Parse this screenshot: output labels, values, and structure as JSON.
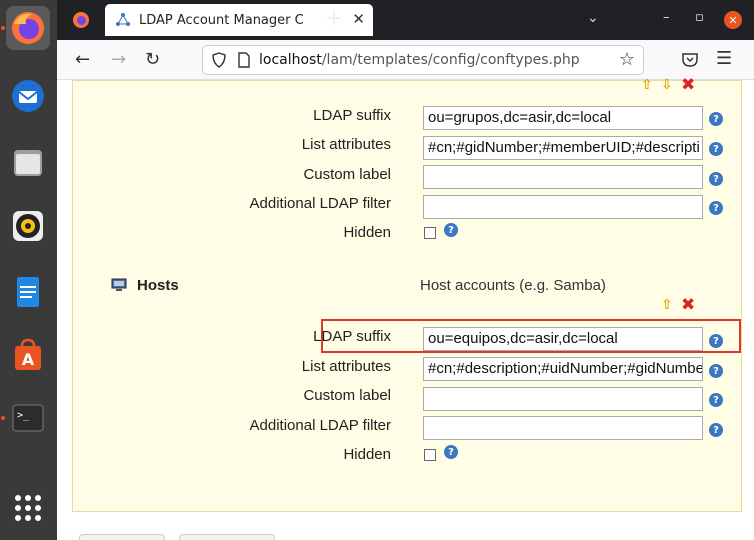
{
  "browser": {
    "tab_title": "LDAP Account Manager C",
    "url_host": "localhost",
    "url_path": "/lam/templates/config/conftypes.php"
  },
  "group_section": {
    "ldap_suffix_label": "LDAP suffix",
    "ldap_suffix_value": "ou=grupos,dc=asir,dc=local",
    "list_attributes_label": "List attributes",
    "list_attributes_value": "#cn;#gidNumber;#memberUID;#descripti",
    "custom_label_label": "Custom label",
    "custom_label_value": "",
    "additional_filter_label": "Additional LDAP filter",
    "additional_filter_value": "",
    "hidden_label": "Hidden"
  },
  "hosts_section": {
    "title": "Hosts",
    "description": "Host accounts (e.g. Samba)",
    "ldap_suffix_label": "LDAP suffix",
    "ldap_suffix_value": "ou=equipos,dc=asir,dc=local",
    "list_attributes_label": "List attributes",
    "list_attributes_value": "#cn;#description;#uidNumber;#gidNumbe",
    "custom_label_label": "Custom label",
    "custom_label_value": "",
    "additional_filter_label": "Additional LDAP filter",
    "additional_filter_value": "",
    "hidden_label": "Hidden"
  },
  "colors": {
    "panel_bg": "#fffde6",
    "highlight": "#d83a2c",
    "help": "#3a78c2",
    "dock_accent": "#e95420"
  }
}
